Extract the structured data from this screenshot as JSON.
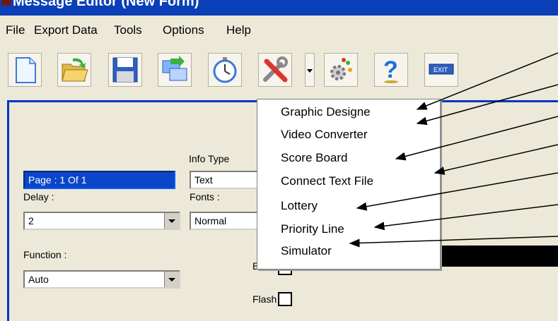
{
  "window": {
    "title": "Message Editor (New Form)"
  },
  "menu": [
    "File",
    "Export Data",
    "Tools",
    "Options",
    "Help"
  ],
  "toolbar": {
    "buttons": [
      "new-icon",
      "open-icon",
      "save-icon",
      "transfer-icon",
      "timer-icon",
      "tools-icon",
      "settings-gear-icon",
      "help-icon",
      "exit-icon"
    ],
    "exit_label": "EXIT"
  },
  "form": {
    "page_field": "Page : 1 Of 1",
    "delay_label": "Delay :",
    "delay_value": "2",
    "function_label": "Function :",
    "function_value": "Auto",
    "info_type_label": "Info Type",
    "info_type_value": "Text",
    "fonts_label": "Fonts :",
    "fonts_value": "Normal",
    "bold_label": "Bold",
    "flash_label": "Flash"
  },
  "tools_dropdown": [
    "Graphic Designe",
    "Video Converter",
    "Score Board",
    "Connect Text File",
    "Lottery",
    "Priority Line",
    "Simulator"
  ]
}
